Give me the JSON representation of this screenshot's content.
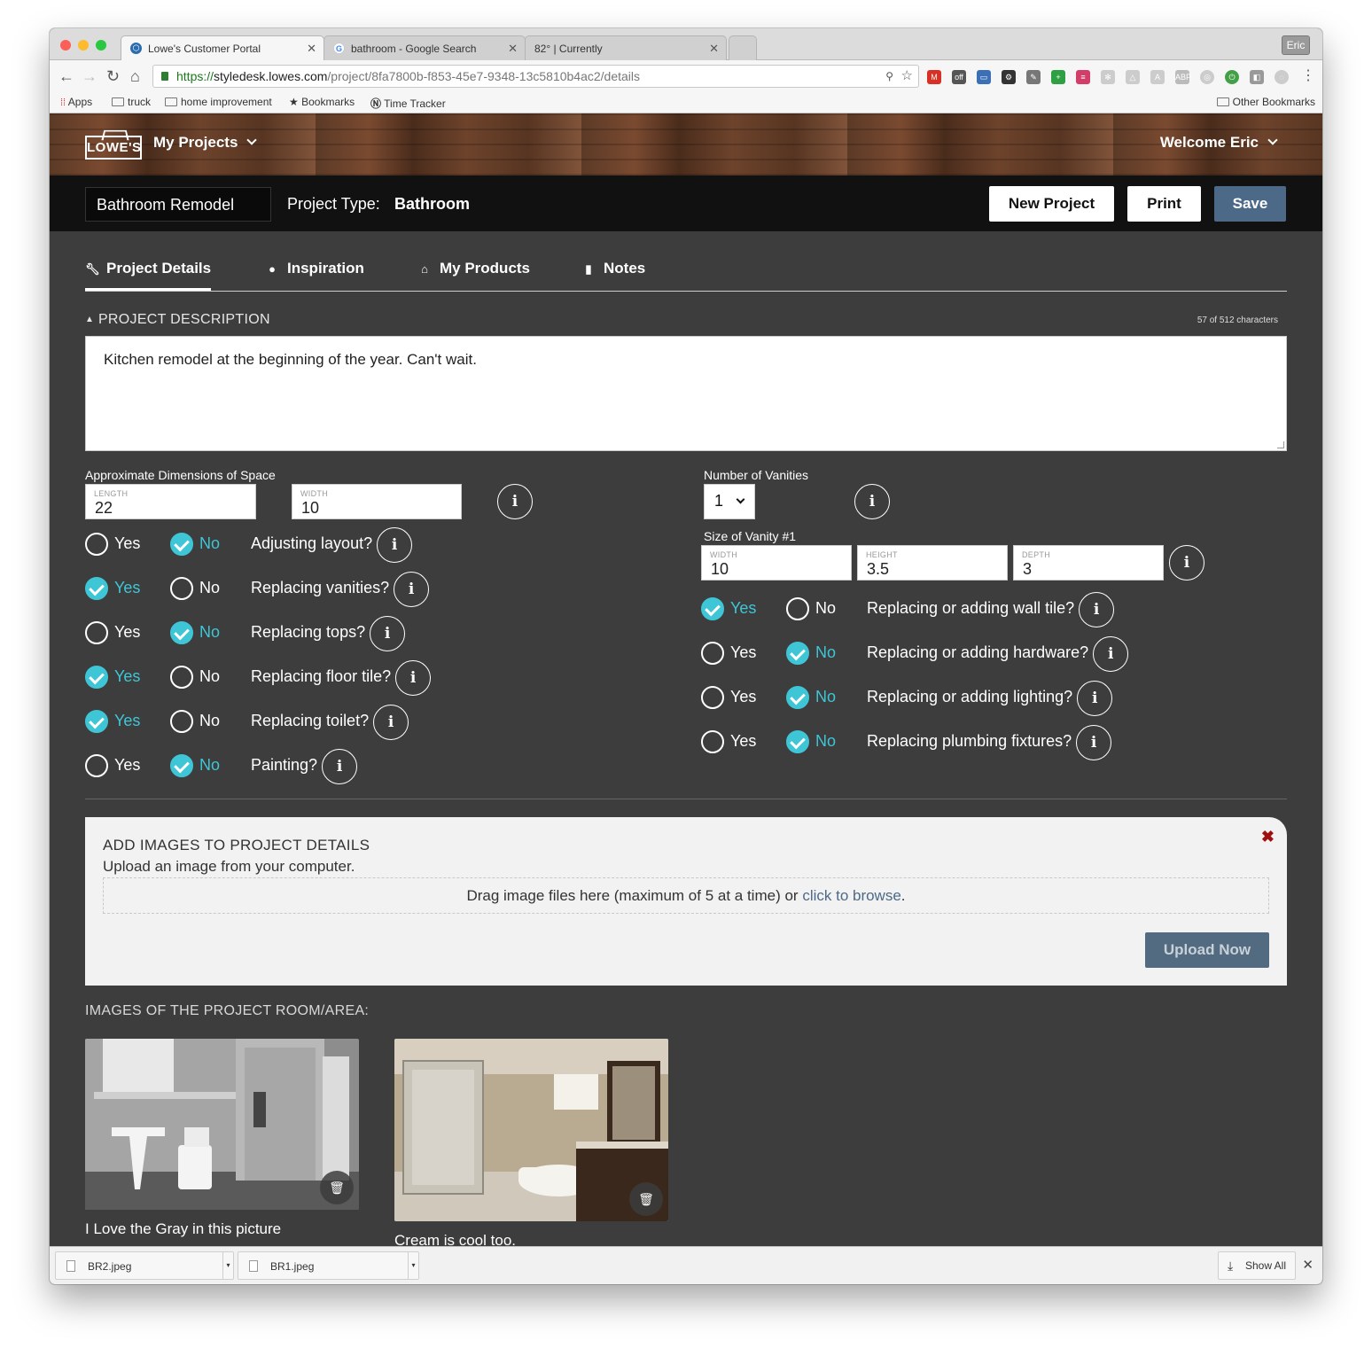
{
  "browser": {
    "tabs": [
      {
        "title": "Lowe's Customer Portal",
        "active": true
      },
      {
        "title": "bathroom - Google Search",
        "active": false
      },
      {
        "title": "82° | Currently",
        "active": false
      }
    ],
    "profile": "Eric",
    "url_scheme": "https://",
    "url_host": "styledesk.lowes.com",
    "url_path": "/project/8fa7800b-f853-45e7-9348-13c5810b4ac2/details",
    "bookmarks": {
      "apps": "Apps",
      "truck": "truck",
      "home_improvement": "home improvement",
      "bookmarks": "Bookmarks",
      "time_tracker": "Time Tracker",
      "other": "Other Bookmarks"
    }
  },
  "header": {
    "logo": "LOWE'S",
    "title": "My Projects",
    "welcome": "Welcome Eric"
  },
  "project_bar": {
    "project_name": "Bathroom Remodel",
    "type_label": "Project Type:",
    "type_value": "Bathroom",
    "new_project": "New Project",
    "print": "Print",
    "save": "Save"
  },
  "tabs": [
    "Project Details",
    "Inspiration",
    "My Products",
    "Notes"
  ],
  "description": {
    "heading": "PROJECT DESCRIPTION",
    "char_count": "57 of 512 characters",
    "text": "Kitchen remodel at the beginning of the year. Can't wait."
  },
  "dimensions": {
    "label": "Approximate Dimensions of Space",
    "length_label": "LENGTH",
    "length": "22",
    "width_label": "WIDTH",
    "width": "10"
  },
  "vanities": {
    "label": "Number of Vanities",
    "count": "1",
    "size_label": "Size of Vanity #1",
    "width_label": "WIDTH",
    "width": "10",
    "height_label": "HEIGHT",
    "height": "3.5",
    "depth_label": "DEPTH",
    "depth": "3"
  },
  "yes_label": "Yes",
  "no_label": "No",
  "info_glyph": "i",
  "questions_left": [
    {
      "q": "Adjusting layout?",
      "answer": "no"
    },
    {
      "q": "Replacing vanities?",
      "answer": "yes"
    },
    {
      "q": "Replacing tops?",
      "answer": "no"
    },
    {
      "q": "Replacing floor tile?",
      "answer": "yes"
    },
    {
      "q": "Replacing toilet?",
      "answer": "yes"
    },
    {
      "q": "Painting?",
      "answer": "no"
    }
  ],
  "questions_right": [
    {
      "q": "Replacing or adding wall tile?",
      "answer": "yes"
    },
    {
      "q": "Replacing or adding hardware?",
      "answer": "no"
    },
    {
      "q": "Replacing or adding lighting?",
      "answer": "no"
    },
    {
      "q": "Replacing plumbing fixtures?",
      "answer": "no"
    }
  ],
  "upload": {
    "title": "ADD IMAGES TO PROJECT DETAILS",
    "subtitle": "Upload an image from your computer.",
    "drop_text": "Drag image files here (maximum of 5 at a time) or ",
    "browse_link": "click to browse",
    "drop_end": ".",
    "close": "✖",
    "button": "Upload Now"
  },
  "images": {
    "heading": "IMAGES OF THE PROJECT ROOM/AREA:",
    "captions": [
      "I Love the Gray in this picture",
      "Cream is cool too."
    ]
  },
  "downloads": {
    "files": [
      "BR2.jpeg",
      "BR1.jpeg"
    ],
    "show_all": "Show All"
  },
  "colors": {
    "accent_check": "#3ec6d6",
    "save_button": "#4c6a87",
    "page_bg": "#3d3d3d",
    "close_x": "#a10e0e"
  }
}
